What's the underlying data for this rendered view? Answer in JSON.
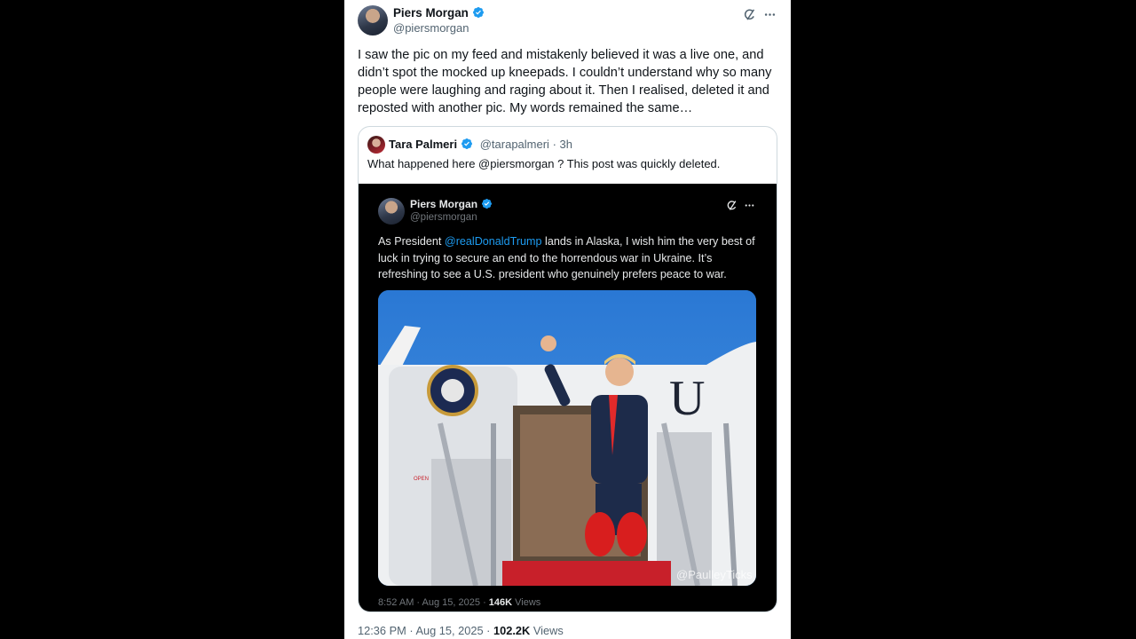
{
  "tweet": {
    "author_name": "Piers Morgan",
    "author_handle": "@piersmorgan",
    "text": "I saw the pic on my feed and mistakenly believed it was a live one, and didn’t spot the mocked up kneepads. I couldn’t understand why so many people were laughing and raging about it. Then I realised, deleted it and reposted with another pic. My words remained the same…",
    "time": "12:36 PM",
    "date": "Aug 15, 2025",
    "views_count": "102.2K",
    "views_label": "Views",
    "separator": "·"
  },
  "quoted": {
    "author_name": "Tara Palmeri",
    "author_handle": "@tarapalmeri",
    "age": "3h",
    "text": "What happened here @piersmorgan ? This post was quickly deleted."
  },
  "screenshot_post": {
    "author_name": "Piers Morgan",
    "author_handle": "@piersmorgan",
    "text_before": "As President ",
    "mention": "@realDonaldTrump",
    "text_after": " lands in Alaska, I wish him the very best of luck in trying to secure an end to the horrendous war in Ukraine. It’s refreshing to see a U.S. president who genuinely prefers peace to war.",
    "image_watermark": "@PaulleyTicks",
    "image_plane_letters": "U",
    "image_door_label": "OPEN",
    "time": "8:52 AM",
    "date": "Aug 15, 2025",
    "views_count": "146K",
    "views_label": "Views"
  },
  "colors": {
    "accent": "#1d9bf0",
    "verified": "#1d9bf0",
    "text": "#0f1419",
    "muted": "#536471",
    "sky": "#2f7fd6"
  },
  "icons": [
    "verified-badge-icon",
    "grok-icon",
    "more-icon"
  ]
}
